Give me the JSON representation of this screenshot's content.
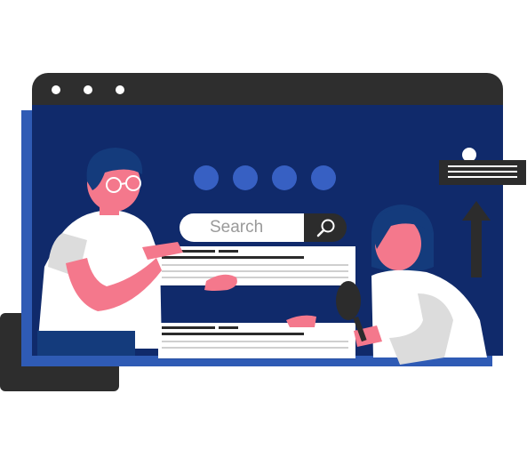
{
  "window": {
    "titlebar_color": "#2e2e2e",
    "body_color": "#102a6b",
    "shadow_color": "#2f5bb5"
  },
  "pagination": {
    "dot_color": "#3760c3",
    "count": 4
  },
  "search": {
    "placeholder": "Search",
    "button_icon": "magnifier-icon"
  },
  "colors": {
    "skin": "#f4788c",
    "hair": "#143b7c",
    "shirt": "#ffffff",
    "sleeve": "#dddddd"
  },
  "icons": [
    "window-dot-icon",
    "magnifier-icon",
    "arrow-up-icon",
    "glasses-icon",
    "magnifying-glass-icon"
  ]
}
